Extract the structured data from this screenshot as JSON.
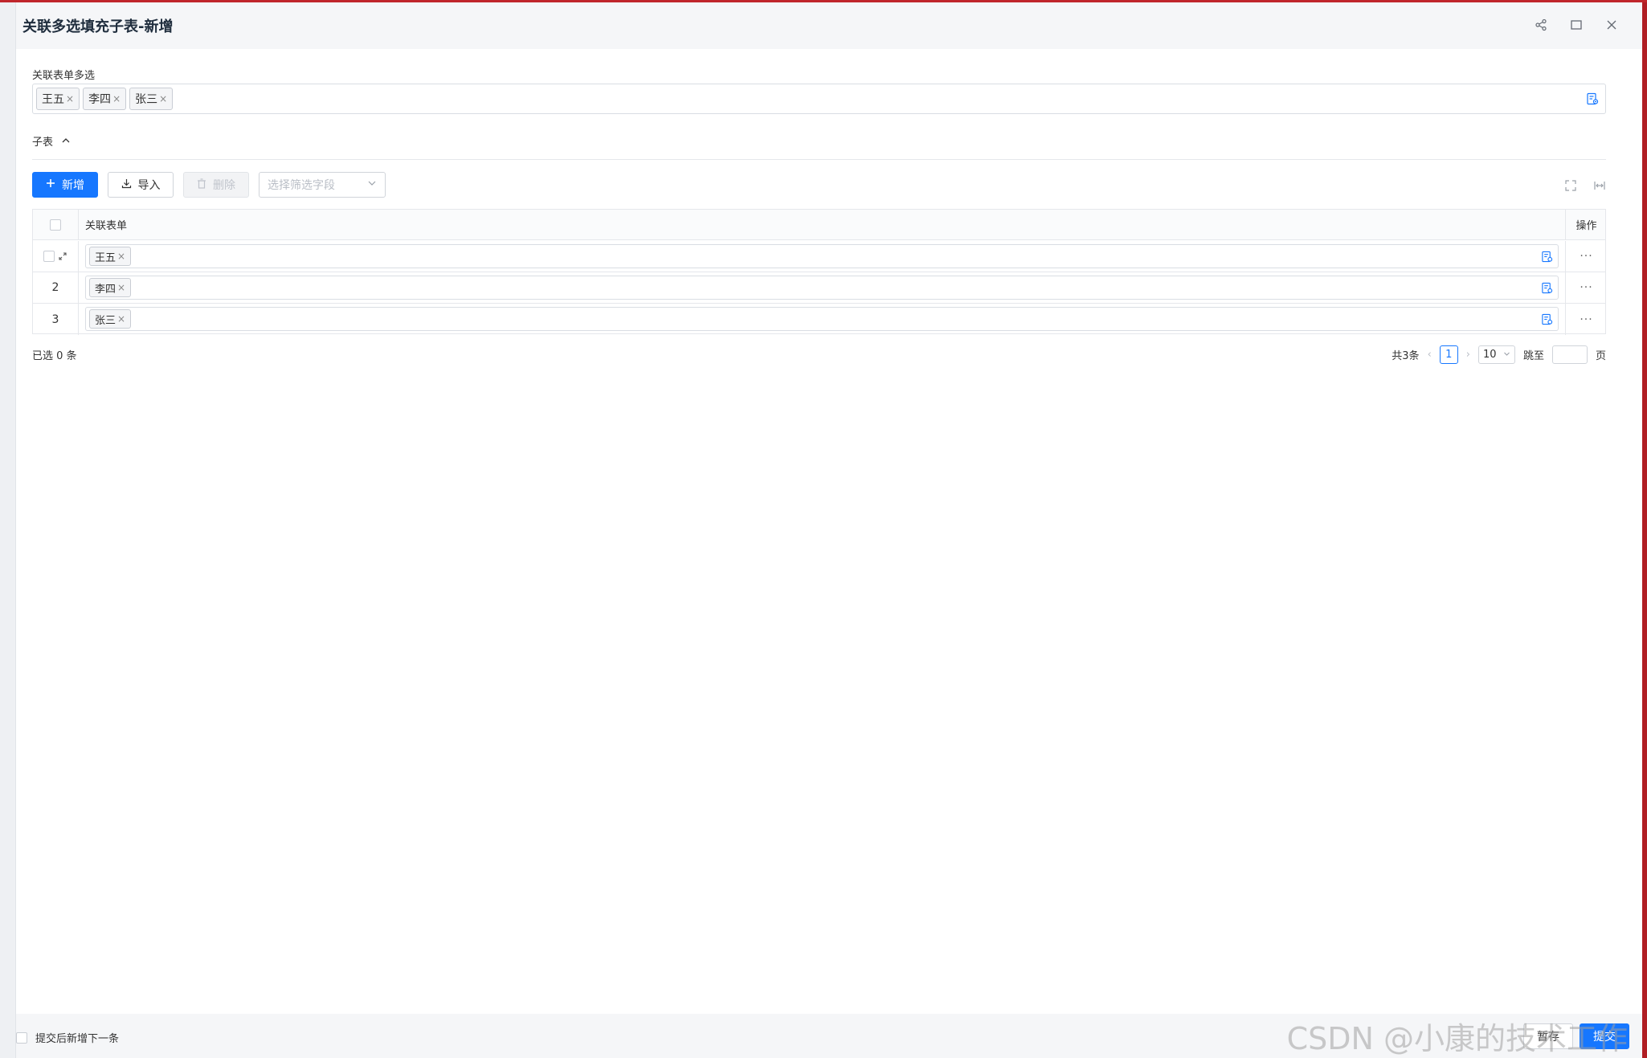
{
  "modal": {
    "title": "关联多选填充子表-新增"
  },
  "main_field": {
    "label": "关联表单多选",
    "tags": [
      "王五",
      "李四",
      "张三"
    ],
    "tag_close": "×"
  },
  "subtable": {
    "title": "子表",
    "toolbar": {
      "add_label": "新增",
      "import_label": "导入",
      "delete_label": "删除",
      "filter_placeholder": "选择筛选字段"
    },
    "columns": {
      "main": "关联表单",
      "op": "操作"
    },
    "rows": [
      {
        "index": "",
        "tag": "王五"
      },
      {
        "index": "2",
        "tag": "李四"
      },
      {
        "index": "3",
        "tag": "张三"
      }
    ],
    "more": "···"
  },
  "pagination": {
    "selected_text": "已选 0 条",
    "total_text": "共3条",
    "current_page": "1",
    "page_size": "10",
    "jump_label": "跳至",
    "page_suffix": "页"
  },
  "footer": {
    "checkbox_label": "提交后新增下一条",
    "save_label": "暂存",
    "submit_label": "提交"
  },
  "watermark": "CSDN @小康的技术工作",
  "colors": {
    "primary": "#1677ff",
    "window_border": "#c0262c"
  },
  "icons": [
    "share-icon",
    "maximize-icon",
    "close-icon",
    "form-select-icon",
    "chevron-up-icon",
    "plus-icon",
    "download-icon",
    "trash-icon",
    "chevron-down-icon",
    "fullscreen-icon",
    "fit-width-icon",
    "expand-row-icon"
  ]
}
